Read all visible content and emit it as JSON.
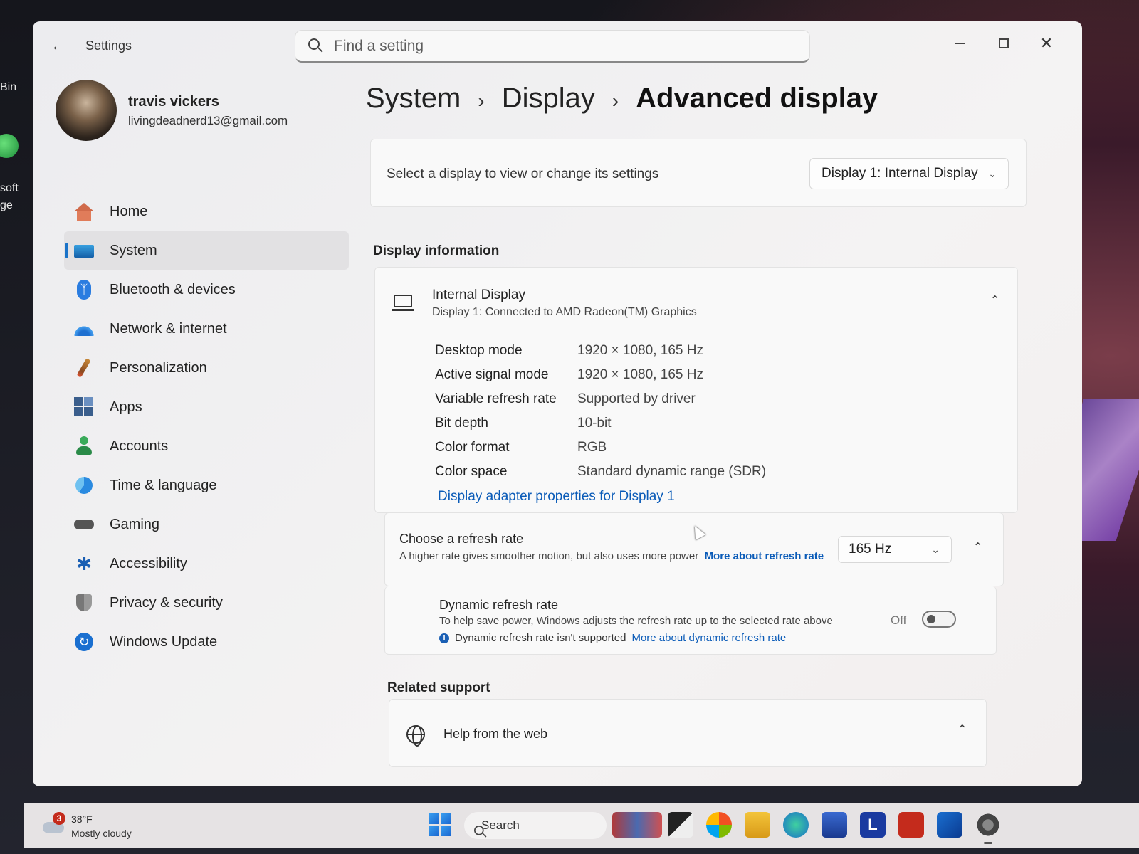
{
  "desktop": {
    "icon_labels": [
      "Bin",
      "soft",
      "ge"
    ]
  },
  "window": {
    "app_title": "Settings",
    "search": {
      "placeholder": "Find a setting"
    }
  },
  "profile": {
    "name": "travis vickers",
    "email": "livingdeadnerd13@gmail.com"
  },
  "sidebar": {
    "items": [
      {
        "label": "Home",
        "icon": "home-icon",
        "active": false
      },
      {
        "label": "System",
        "icon": "system-icon",
        "active": true
      },
      {
        "label": "Bluetooth & devices",
        "icon": "bluetooth-icon",
        "active": false
      },
      {
        "label": "Network & internet",
        "icon": "wifi-icon",
        "active": false
      },
      {
        "label": "Personalization",
        "icon": "brush-icon",
        "active": false
      },
      {
        "label": "Apps",
        "icon": "apps-icon",
        "active": false
      },
      {
        "label": "Accounts",
        "icon": "accounts-icon",
        "active": false
      },
      {
        "label": "Time & language",
        "icon": "clock-globe-icon",
        "active": false
      },
      {
        "label": "Gaming",
        "icon": "gamepad-icon",
        "active": false
      },
      {
        "label": "Accessibility",
        "icon": "accessibility-icon",
        "active": false
      },
      {
        "label": "Privacy & security",
        "icon": "shield-icon",
        "active": false
      },
      {
        "label": "Windows Update",
        "icon": "update-icon",
        "active": false
      }
    ]
  },
  "breadcrumb": [
    "System",
    "Display",
    "Advanced display"
  ],
  "display_select": {
    "label": "Select a display to view or change its settings",
    "selected": "Display 1: Internal Display"
  },
  "display_info": {
    "section_title": "Display information",
    "name": "Internal Display",
    "subtitle": "Display 1: Connected to AMD Radeon(TM) Graphics",
    "rows": [
      {
        "key": "Desktop mode",
        "value": "1920 × 1080, 165 Hz"
      },
      {
        "key": "Active signal mode",
        "value": "1920 × 1080, 165 Hz"
      },
      {
        "key": "Variable refresh rate",
        "value": "Supported by driver"
      },
      {
        "key": "Bit depth",
        "value": "10-bit"
      },
      {
        "key": "Color format",
        "value": "RGB"
      },
      {
        "key": "Color space",
        "value": "Standard dynamic range (SDR)"
      }
    ],
    "adapter_link": "Display adapter properties for Display 1"
  },
  "refresh_rate": {
    "title": "Choose a refresh rate",
    "description": "A higher rate gives smoother motion, but also uses more power",
    "link": "More about refresh rate",
    "selected": "165 Hz"
  },
  "dynamic_refresh": {
    "title": "Dynamic refresh rate",
    "description": "To help save power, Windows adjusts the refresh rate up to the selected rate above",
    "note": "Dynamic refresh rate isn't supported",
    "link": "More about dynamic refresh rate",
    "toggle_label": "Off",
    "toggle_on": false
  },
  "related_support": {
    "section_title": "Related support",
    "help_item": "Help from the web"
  },
  "taskbar": {
    "weather": {
      "badge": "3",
      "temp": "38°F",
      "condition": "Mostly cloudy"
    },
    "search_label": "Search"
  },
  "colors": {
    "accent": "#1a73c8",
    "link": "#0a5bb8"
  }
}
